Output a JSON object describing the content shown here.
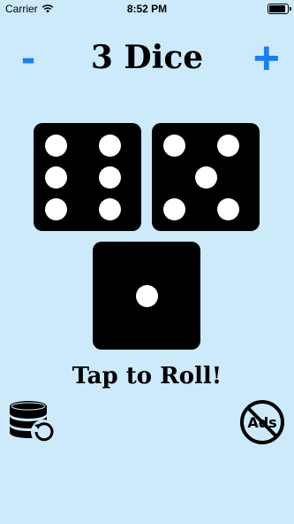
{
  "status_bar": {
    "carrier": "Carrier",
    "time": "8:52 PM",
    "battery_level": 0.9
  },
  "header": {
    "minus_label": "-",
    "title": "3 Dice",
    "plus_label": "+"
  },
  "dice": [
    {
      "value": 6
    },
    {
      "value": 5
    },
    {
      "value": 1
    }
  ],
  "prompt": "Tap to Roll!",
  "icons": {
    "left": "database-restore-icon",
    "right": "no-ads-icon"
  },
  "icon_text": {
    "no_ads": "Ads"
  },
  "colors": {
    "background": "#cdeafb",
    "accent": "#1a7ef5",
    "die": "#000000",
    "pip": "#ffffff"
  }
}
